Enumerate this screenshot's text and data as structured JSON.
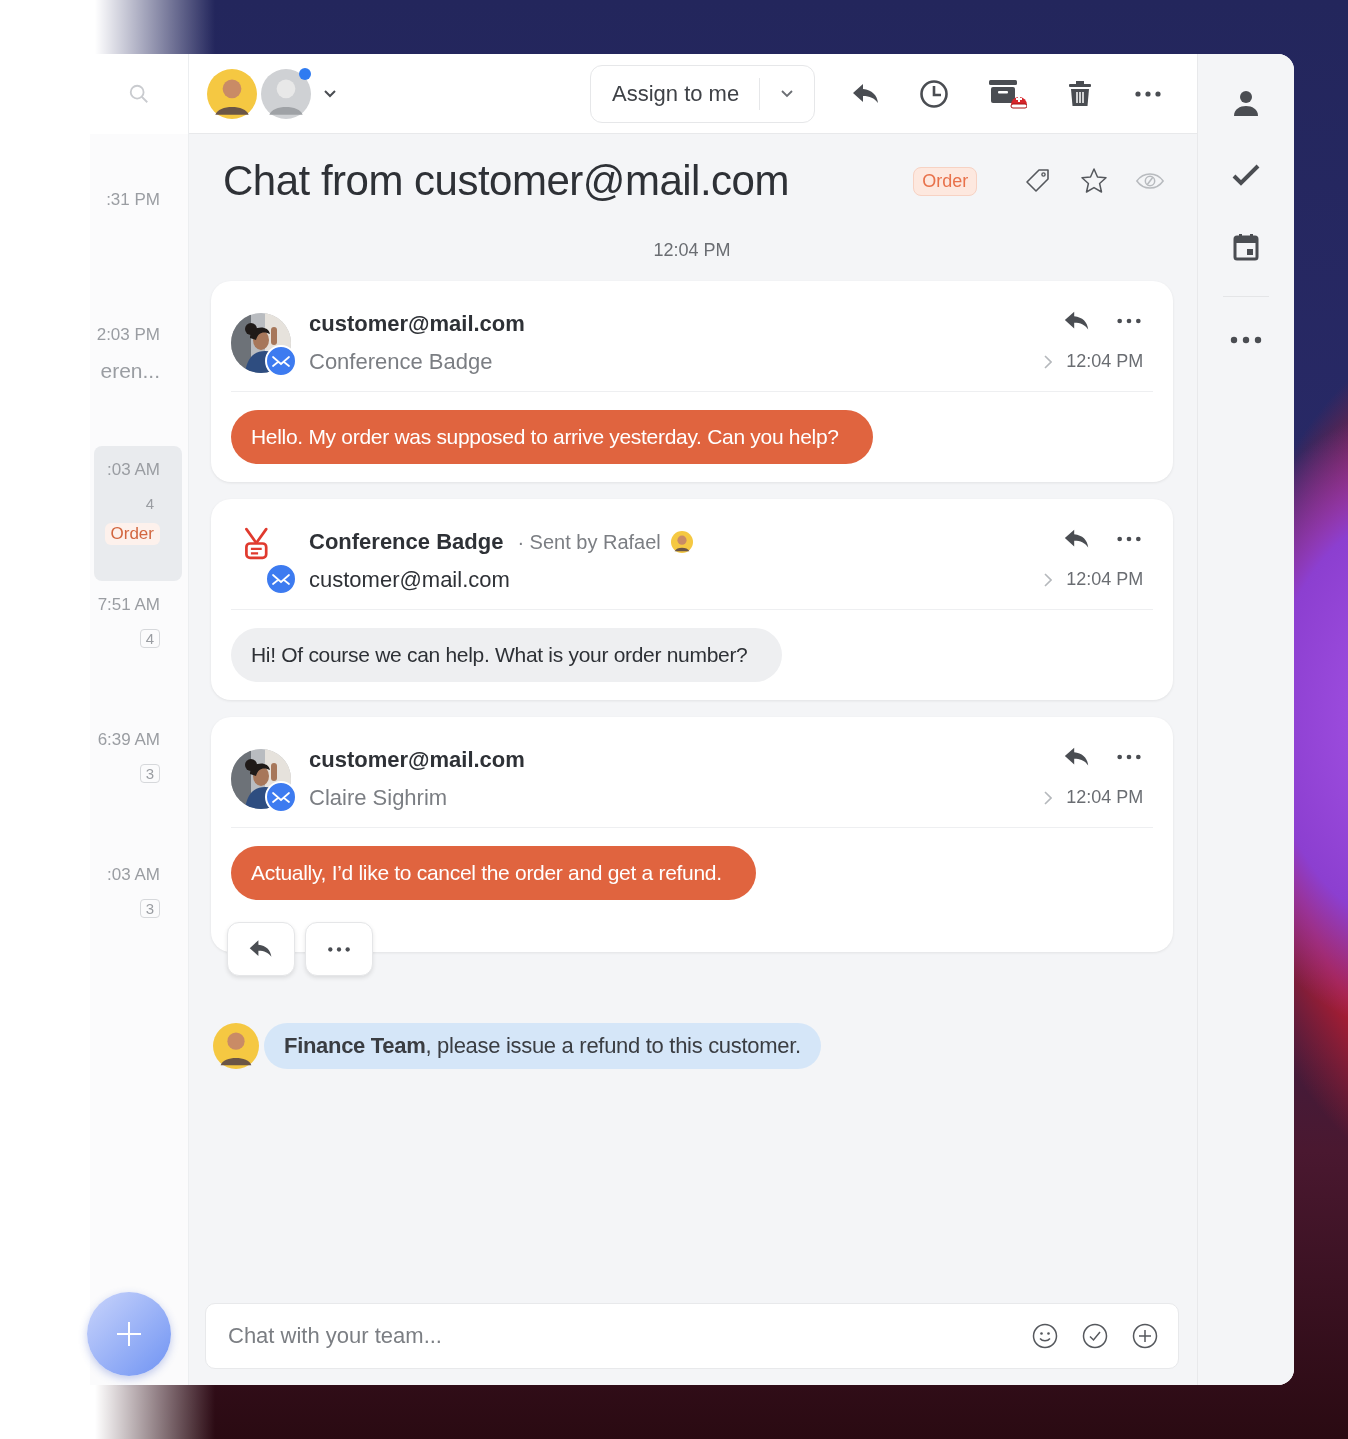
{
  "conversation_list": {
    "items": [
      {
        "time": ":31 PM",
        "selected": false
      },
      {
        "time": "2:03 PM",
        "subject": "eren...",
        "selected": false
      },
      {
        "time": ":03 AM",
        "count": "4",
        "tag": "Order",
        "selected": true
      },
      {
        "time": "7:51 AM",
        "count": "4",
        "selected": false
      },
      {
        "time": "6:39 AM",
        "count": "3",
        "selected": false
      },
      {
        "time": ":03 AM",
        "count": "3",
        "selected": false
      }
    ]
  },
  "header": {
    "assignees": [
      {
        "online": false
      },
      {
        "online": true
      }
    ],
    "assign_button": {
      "label": "Assign to me"
    }
  },
  "conversation": {
    "title": "Chat from customer@mail.com",
    "tag": "Order",
    "starred": false,
    "timestamp": "12:04 PM",
    "messages": [
      {
        "kind": "customer",
        "sender": "customer@mail.com",
        "subtitle": "Conference Badge",
        "time": "12:04 PM",
        "text": "Hello. My order was supposed to arrive yesterday. Can you help?",
        "show_actions": false
      },
      {
        "kind": "agent",
        "sender": "Conference Badge",
        "sent_by": "· Sent by Rafael",
        "subtitle": "customer@mail.com",
        "time": "12:04 PM",
        "text": "Hi! Of course we can help. What is your order number?",
        "show_actions": false
      },
      {
        "kind": "customer",
        "sender": "customer@mail.com",
        "subtitle": "Claire Sighrim",
        "time": "12:04 PM",
        "text": "Actually, I’d like to cancel the order and get a refund.",
        "show_actions": true
      }
    ],
    "note": {
      "text": "**Finance Team**, please issue a refund to this customer."
    }
  },
  "composer": {
    "placeholder": "Chat with your team..."
  }
}
